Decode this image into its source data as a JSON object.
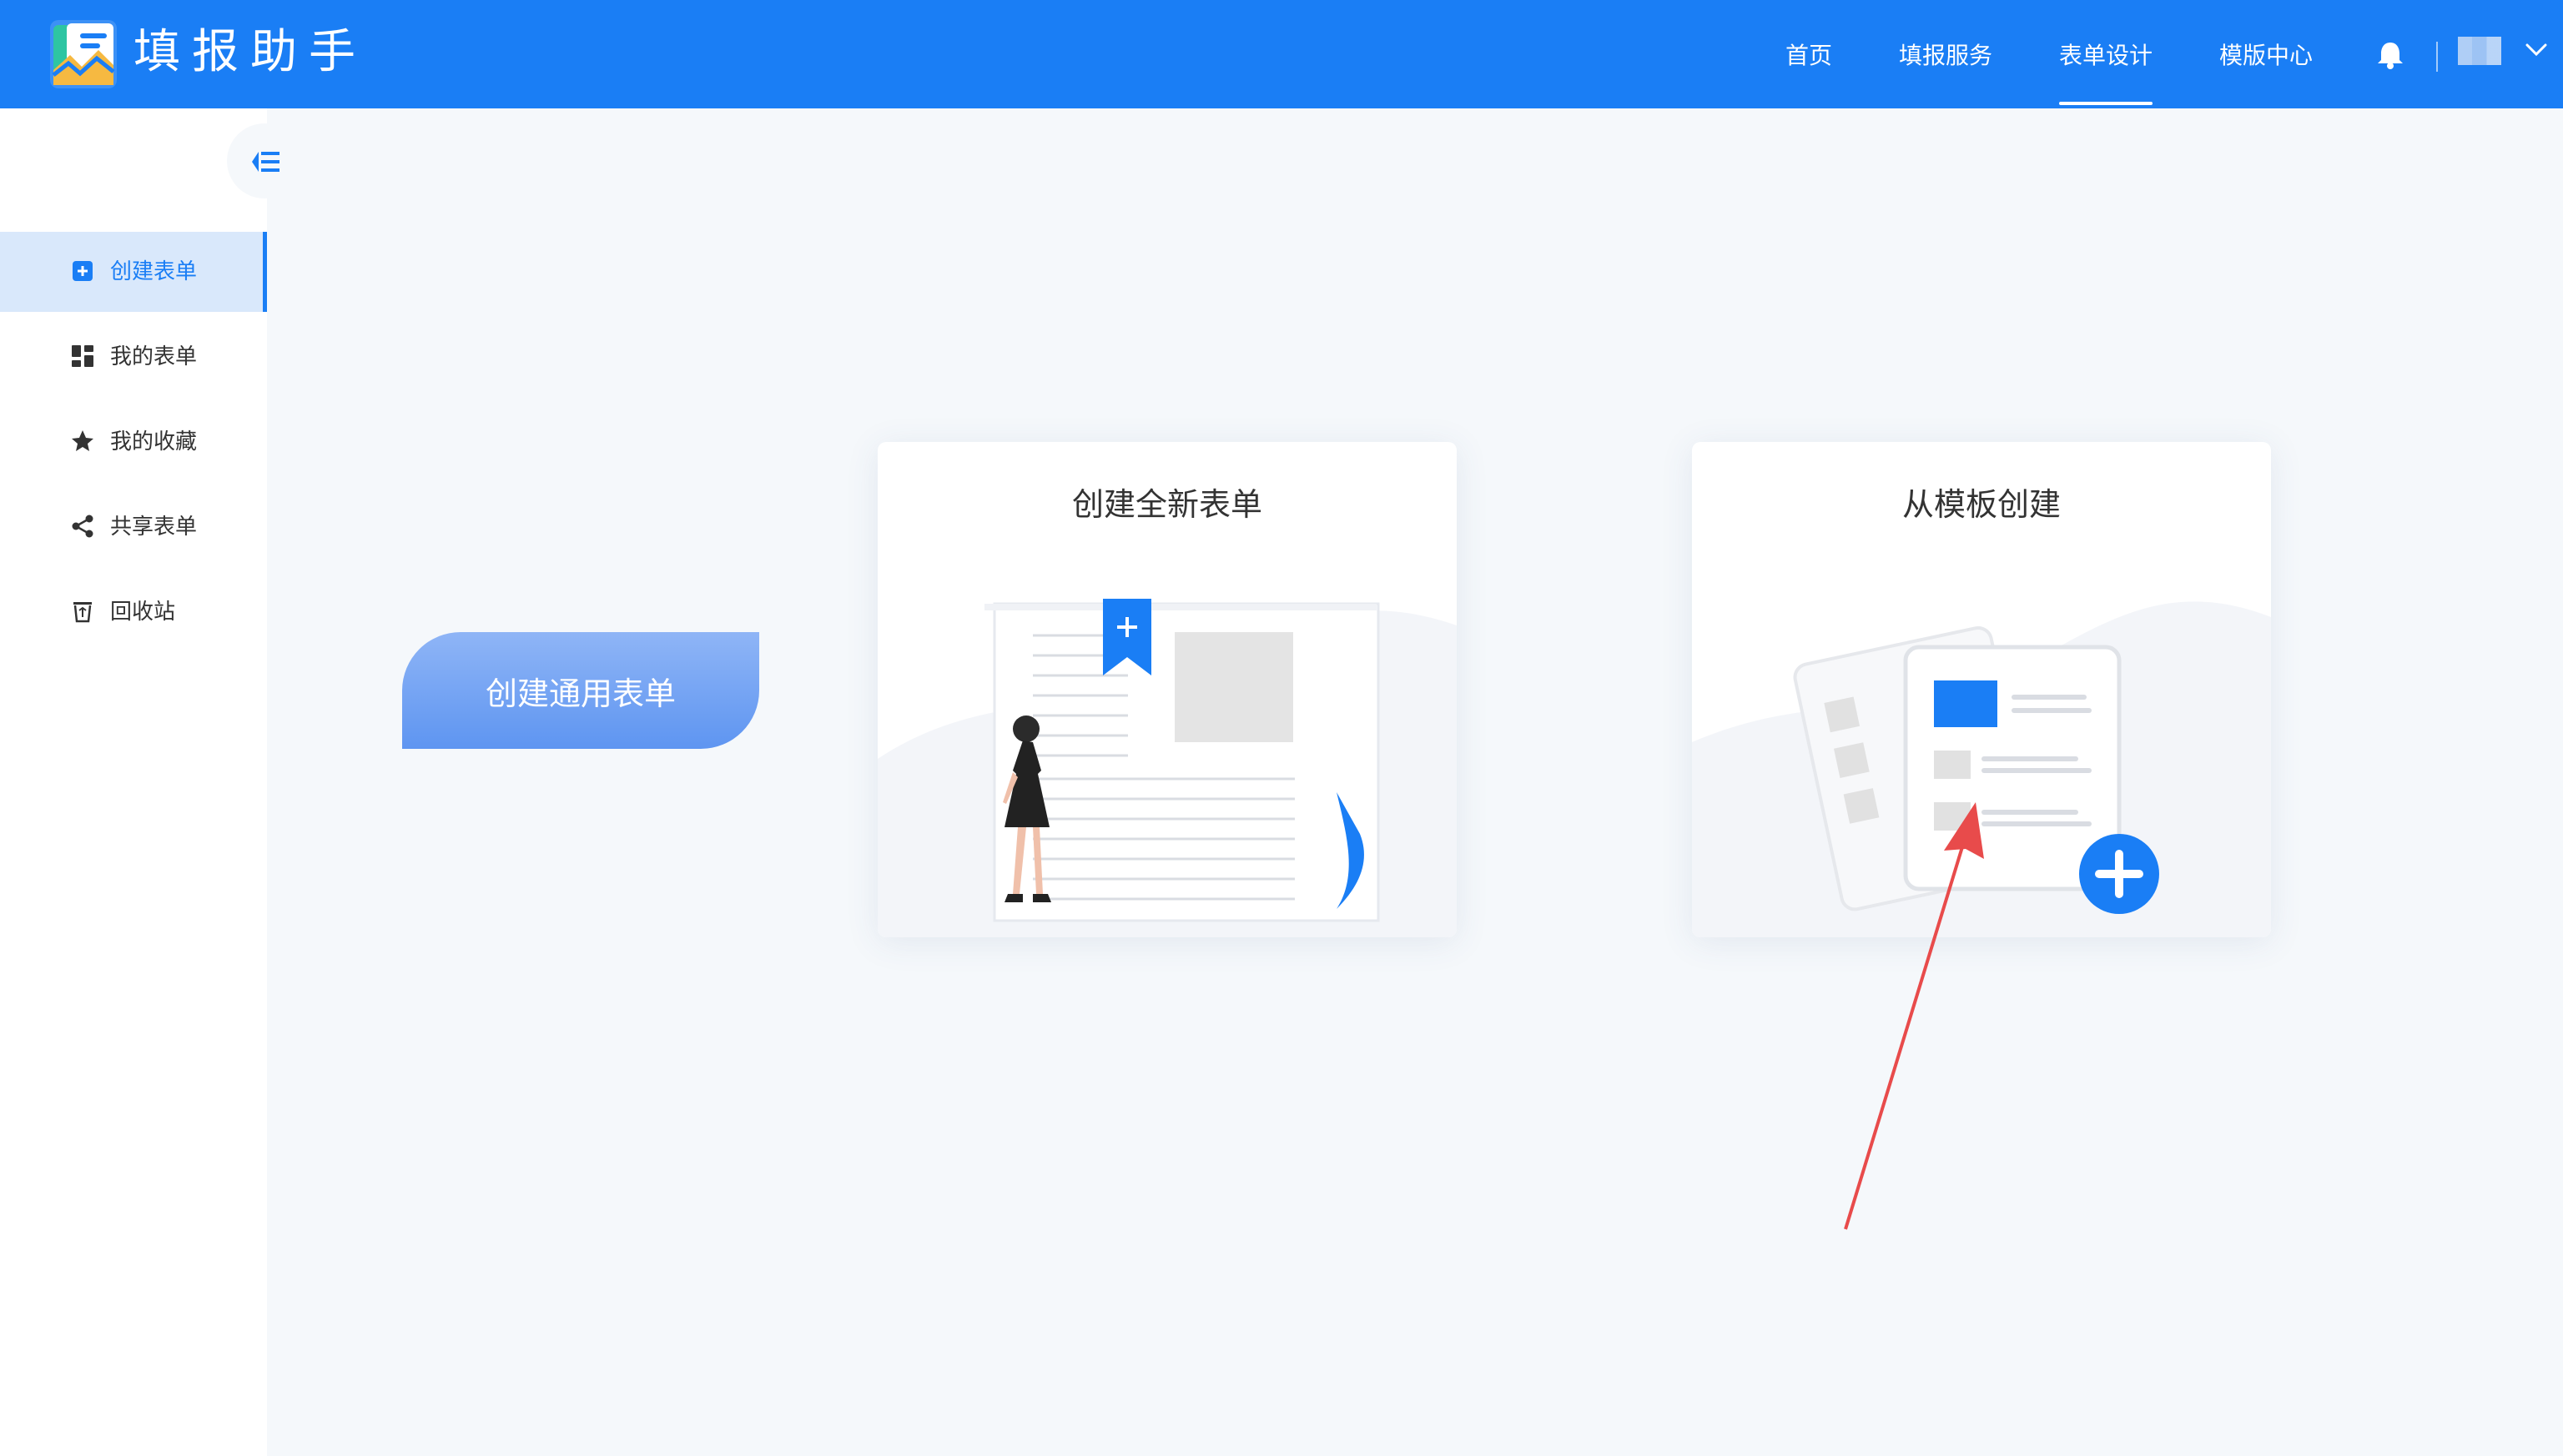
{
  "app": {
    "title": "填报助手",
    "logo_icon": "app-logo-icon"
  },
  "nav": {
    "items": [
      {
        "label": "首页",
        "active": false
      },
      {
        "label": "填报服务",
        "active": false
      },
      {
        "label": "表单设计",
        "active": true
      },
      {
        "label": "模版中心",
        "active": false
      }
    ],
    "bell_icon": "bell-icon",
    "avatar": "user-avatar",
    "chevron_icon": "chevron-down-icon"
  },
  "sidebar": {
    "collapse_icon": "collapse-menu-icon",
    "items": [
      {
        "label": "创建表单",
        "icon": "add-form-icon",
        "active": true
      },
      {
        "label": "我的表单",
        "icon": "grid-icon",
        "active": false
      },
      {
        "label": "我的收藏",
        "icon": "star-icon",
        "active": false
      },
      {
        "label": "共享表单",
        "icon": "share-icon",
        "active": false
      },
      {
        "label": "回收站",
        "icon": "trash-icon",
        "active": false
      }
    ]
  },
  "main": {
    "create_general_label": "创建通用表单",
    "cards": [
      {
        "title": "创建全新表单",
        "illustration": "new-form-illustration"
      },
      {
        "title": "从模板创建",
        "illustration": "template-illustration"
      }
    ]
  },
  "colors": {
    "primary": "#1a7ef5",
    "background": "#f5f8fb",
    "annotation": "#e84b4b"
  }
}
